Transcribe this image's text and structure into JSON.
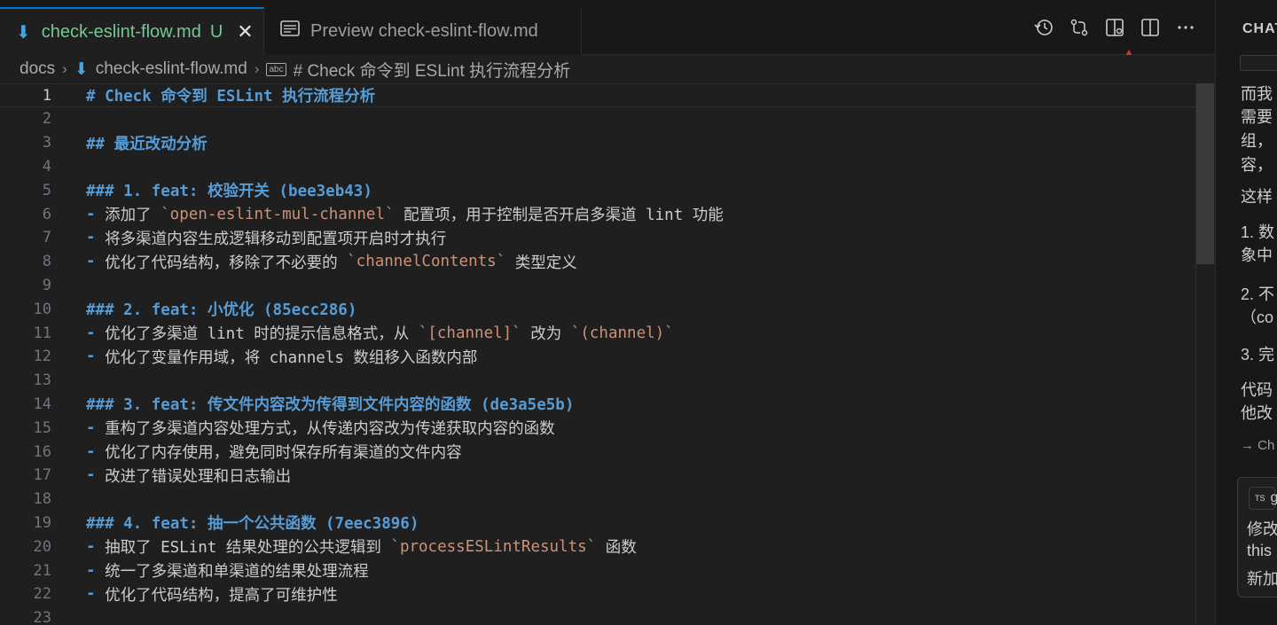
{
  "tabs": [
    {
      "icon": "markdown-icon",
      "label": "check-eslint-flow.md",
      "status": "U",
      "close": "✕"
    },
    {
      "icon": "preview-icon",
      "label": "Preview check-eslint-flow.md"
    }
  ],
  "breadcrumb": {
    "folder": "docs",
    "file": "check-eslint-flow.md",
    "symbol_badge": "abc",
    "symbol": "# Check 命令到 ESLint 执行流程分析"
  },
  "editor": {
    "current_line": 1,
    "lines": [
      {
        "n": "1",
        "parts": [
          {
            "t": "# Check 命令到 ESLint 执行流程分析",
            "k": "h"
          }
        ]
      },
      {
        "n": "2",
        "parts": []
      },
      {
        "n": "3",
        "parts": [
          {
            "t": "## 最近改动分析",
            "k": "h"
          }
        ]
      },
      {
        "n": "4",
        "parts": []
      },
      {
        "n": "5",
        "parts": [
          {
            "t": "### 1. feat: 校验开关 (bee3eb43)",
            "k": "h"
          }
        ]
      },
      {
        "n": "6",
        "parts": [
          {
            "t": "- ",
            "k": "h"
          },
          {
            "t": "添加了 ",
            "k": "t"
          },
          {
            "t": "`open-eslint-mul-channel`",
            "k": "c"
          },
          {
            "t": " 配置项，用于控制是否开启多渠道 lint 功能",
            "k": "t"
          }
        ]
      },
      {
        "n": "7",
        "parts": [
          {
            "t": "- ",
            "k": "h"
          },
          {
            "t": "将多渠道内容生成逻辑移动到配置项开启时才执行",
            "k": "t"
          }
        ]
      },
      {
        "n": "8",
        "parts": [
          {
            "t": "- ",
            "k": "h"
          },
          {
            "t": "优化了代码结构，移除了不必要的 ",
            "k": "t"
          },
          {
            "t": "`channelContents`",
            "k": "c"
          },
          {
            "t": " 类型定义",
            "k": "t"
          }
        ]
      },
      {
        "n": "9",
        "parts": []
      },
      {
        "n": "10",
        "parts": [
          {
            "t": "### 2. feat: 小优化 (85ecc286)",
            "k": "h"
          }
        ]
      },
      {
        "n": "11",
        "parts": [
          {
            "t": "- ",
            "k": "h"
          },
          {
            "t": "优化了多渠道 lint 时的提示信息格式，从 ",
            "k": "t"
          },
          {
            "t": "`[channel]`",
            "k": "c"
          },
          {
            "t": " 改为 ",
            "k": "t"
          },
          {
            "t": "`(channel)`",
            "k": "c"
          }
        ]
      },
      {
        "n": "12",
        "parts": [
          {
            "t": "- ",
            "k": "h"
          },
          {
            "t": "优化了变量作用域，将 channels 数组移入函数内部",
            "k": "t"
          }
        ]
      },
      {
        "n": "13",
        "parts": []
      },
      {
        "n": "14",
        "parts": [
          {
            "t": "### 3. feat: 传文件内容改为传得到文件内容的函数 (de3a5e5b)",
            "k": "h"
          }
        ]
      },
      {
        "n": "15",
        "parts": [
          {
            "t": "- ",
            "k": "h"
          },
          {
            "t": "重构了多渠道内容处理方式，从传递内容改为传递获取内容的函数",
            "k": "t"
          }
        ]
      },
      {
        "n": "16",
        "parts": [
          {
            "t": "- ",
            "k": "h"
          },
          {
            "t": "优化了内存使用，避免同时保存所有渠道的文件内容",
            "k": "t"
          }
        ]
      },
      {
        "n": "17",
        "parts": [
          {
            "t": "- ",
            "k": "h"
          },
          {
            "t": "改进了错误处理和日志输出",
            "k": "t"
          }
        ]
      },
      {
        "n": "18",
        "parts": []
      },
      {
        "n": "19",
        "parts": [
          {
            "t": "### 4. feat: 抽一个公共函数 (7eec3896)",
            "k": "h"
          }
        ]
      },
      {
        "n": "20",
        "parts": [
          {
            "t": "- ",
            "k": "h"
          },
          {
            "t": "抽取了 ESLint 结果处理的公共逻辑到 ",
            "k": "t"
          },
          {
            "t": "`processESLintResults`",
            "k": "c"
          },
          {
            "t": " 函数",
            "k": "t"
          }
        ]
      },
      {
        "n": "21",
        "parts": [
          {
            "t": "- ",
            "k": "h"
          },
          {
            "t": "统一了多渠道和单渠道的结果处理流程",
            "k": "t"
          }
        ]
      },
      {
        "n": "22",
        "parts": [
          {
            "t": "- ",
            "k": "h"
          },
          {
            "t": "优化了代码结构，提高了可维护性",
            "k": "t"
          }
        ]
      },
      {
        "n": "23",
        "parts": []
      }
    ]
  },
  "chat": {
    "title": "CHAT",
    "lines": [
      "而我",
      "需要",
      "组，",
      "容，",
      "这样",
      "1. 数",
      "象中",
      "2. 不",
      "（co",
      "3. 完",
      "代码",
      "他改"
    ],
    "footer": "→ Ch",
    "card": {
      "badge": "TS",
      "file": "g",
      "lines": [
        "修改",
        "this",
        "新加"
      ]
    }
  },
  "colors": {
    "accent": "#0078d4",
    "heading": "#569cd6",
    "code": "#ce9178",
    "untracked": "#73c991",
    "arrow": "#d0342c"
  }
}
